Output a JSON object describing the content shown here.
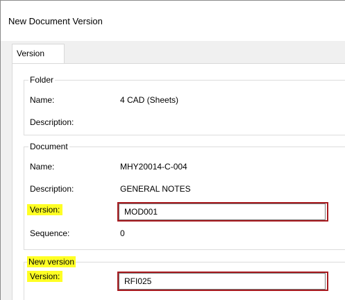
{
  "window": {
    "title": "New Document Version"
  },
  "tabs": [
    {
      "label": "Version"
    }
  ],
  "folder": {
    "legend": "Folder",
    "name_label": "Name:",
    "name_value": "4 CAD (Sheets)",
    "description_label": "Description:",
    "description_value": ""
  },
  "document": {
    "legend": "Document",
    "name_label": "Name:",
    "name_value": "MHY20014-C-004",
    "description_label": "Description:",
    "description_value": "GENERAL NOTES",
    "version_label": "Version:",
    "version_value": "MOD001",
    "sequence_label": "Sequence:",
    "sequence_value": "0"
  },
  "new_version": {
    "legend": "New version",
    "version_label": "Version:",
    "version_value": "RFI025"
  },
  "colors": {
    "highlight": "#ffff24",
    "annotation_border": "#a8191e"
  }
}
